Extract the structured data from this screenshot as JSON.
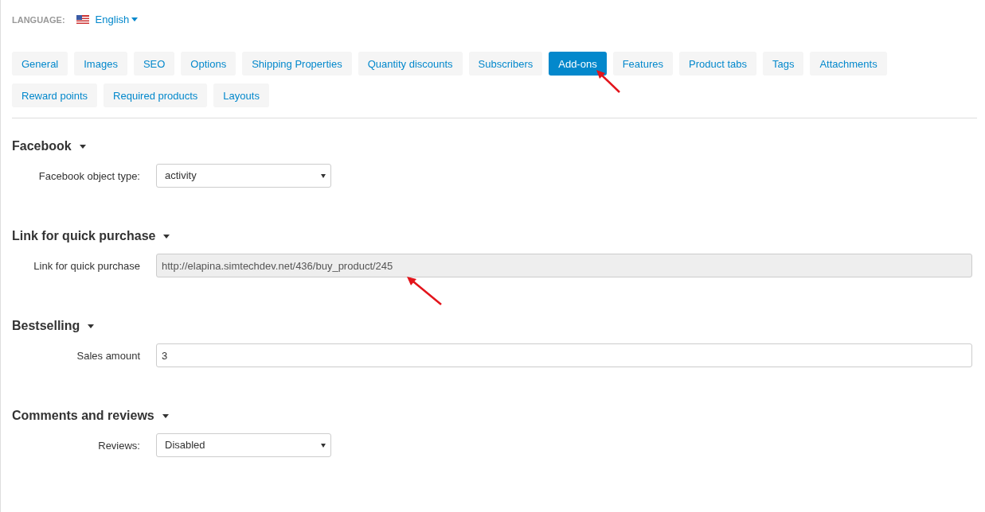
{
  "language": {
    "label": "LANGUAGE:",
    "value": "English"
  },
  "tabs": [
    {
      "label": "General",
      "selected": false
    },
    {
      "label": "Images",
      "selected": false
    },
    {
      "label": "SEO",
      "selected": false
    },
    {
      "label": "Options",
      "selected": false
    },
    {
      "label": "Shipping Properties",
      "selected": false
    },
    {
      "label": "Quantity discounts",
      "selected": false
    },
    {
      "label": "Subscribers",
      "selected": false
    },
    {
      "label": "Add-ons",
      "selected": true
    },
    {
      "label": "Features",
      "selected": false
    },
    {
      "label": "Product tabs",
      "selected": false
    },
    {
      "label": "Tags",
      "selected": false
    },
    {
      "label": "Attachments",
      "selected": false
    },
    {
      "label": "Reward points",
      "selected": false
    },
    {
      "label": "Required products",
      "selected": false
    },
    {
      "label": "Layouts",
      "selected": false
    }
  ],
  "sections": [
    {
      "title": "Facebook",
      "fields": [
        {
          "kind": "select",
          "label": "Facebook object type:",
          "value": "activity"
        }
      ]
    },
    {
      "title": "Link for quick purchase",
      "fields": [
        {
          "kind": "readonly",
          "label": "Link for quick purchase",
          "value": "http://elapina.simtechdev.net/436/buy_product/245"
        }
      ]
    },
    {
      "title": "Bestselling",
      "fields": [
        {
          "kind": "text",
          "label": "Sales amount",
          "value": "3"
        }
      ]
    },
    {
      "title": "Comments and reviews",
      "fields": [
        {
          "kind": "select",
          "label": "Reviews:",
          "value": "Disabled"
        }
      ]
    }
  ]
}
